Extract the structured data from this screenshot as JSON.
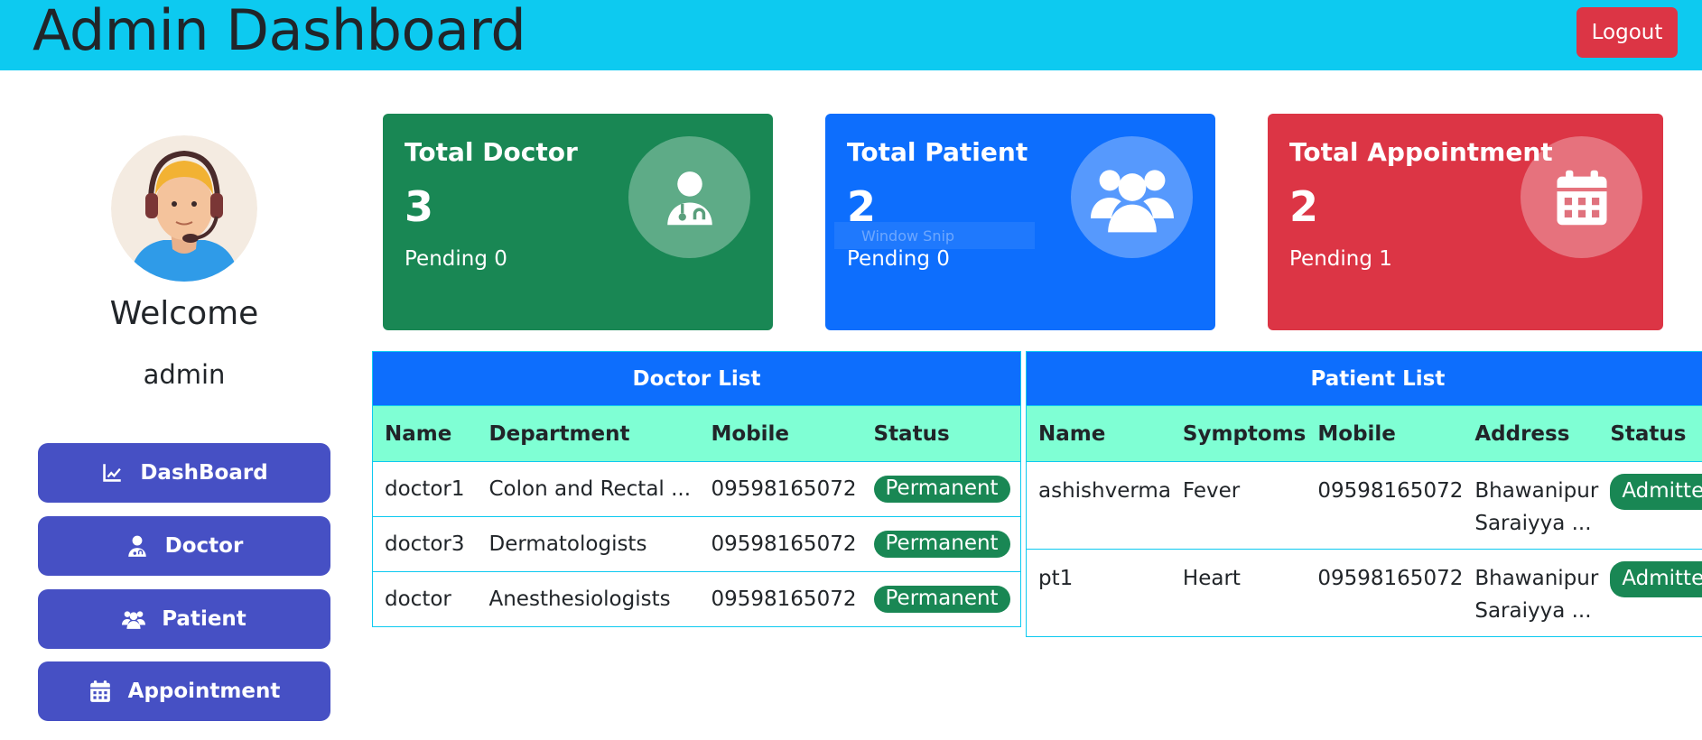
{
  "header": {
    "title": "Admin Dashboard",
    "logout_label": "Logout"
  },
  "colors": {
    "header_bg": "#0dcaf0",
    "nav_bg": "#4650c4",
    "card_doctor": "#198754",
    "card_patient": "#0d6efd",
    "card_appointment": "#dc3545",
    "table_head": "#0d6efd",
    "column_head": "#7fffd4",
    "badge": "#198754",
    "logout": "#dc3545"
  },
  "sidebar": {
    "welcome": "Welcome",
    "username": "admin",
    "items": [
      {
        "label": "DashBoard",
        "icon": "chart-line-icon"
      },
      {
        "label": "Doctor",
        "icon": "user-doctor-icon"
      },
      {
        "label": "Patient",
        "icon": "users-icon"
      },
      {
        "label": "Appointment",
        "icon": "calendar-icon"
      }
    ]
  },
  "cards": {
    "doctor": {
      "title": "Total Doctor",
      "count": "3",
      "pending": "Pending 0",
      "icon": "user-doctor-icon"
    },
    "patient": {
      "title": "Total Patient",
      "count": "2",
      "pending": "Pending 0",
      "icon": "users-icon"
    },
    "appointment": {
      "title": "Total Appointment",
      "count": "2",
      "pending": "Pending 1",
      "icon": "calendar-icon"
    }
  },
  "overlay_text": "Window Snip",
  "doctor_table": {
    "title": "Doctor List",
    "columns": [
      "Name",
      "Department",
      "Mobile",
      "Status"
    ],
    "rows": [
      [
        "doctor1",
        "Colon and Rectal ...",
        "09598165072",
        "Permanent"
      ],
      [
        "doctor3",
        "Dermatologists",
        "09598165072",
        "Permanent"
      ],
      [
        "doctor",
        "Anesthesiologists",
        "09598165072",
        "Permanent"
      ]
    ]
  },
  "patient_table": {
    "title": "Patient List",
    "columns": [
      "Name",
      "Symptoms",
      "Mobile",
      "Address",
      "Status"
    ],
    "rows": [
      [
        "ashishverma",
        "Fever",
        "09598165072",
        "Bhawanipur Saraiyya ...",
        "Admitted"
      ],
      [
        "pt1",
        "Heart",
        "09598165072",
        "Bhawanipur Saraiyya ...",
        "Admitted"
      ]
    ]
  }
}
